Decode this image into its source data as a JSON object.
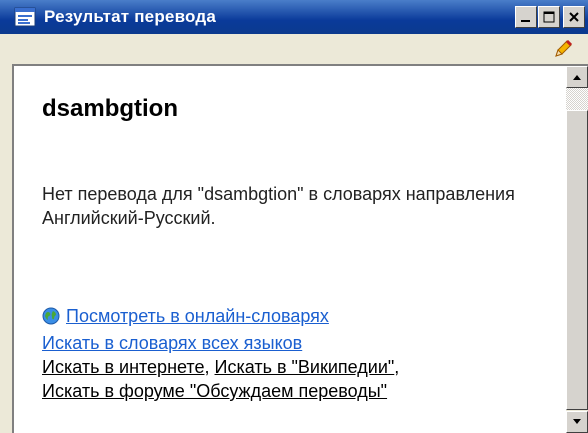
{
  "window": {
    "title": "Результат перевода",
    "icons": {
      "app": "dictionary-window-icon",
      "tool": "pencil-icon"
    }
  },
  "content": {
    "word": "dsambgtion",
    "message": "Нет перевода для \"dsambgtion\" в словарях направления Английский-Русский.",
    "links": {
      "online": "Посмотреть в онлайн-словарях",
      "all_languages": "Искать в словарях всех языков",
      "internet": "Искать в интернете",
      "wikipedia": "Искать в \"Википедии\"",
      "forum": "Искать в форуме \"Обсуждаем переводы\""
    },
    "separators": {
      "comma": ","
    }
  },
  "colors": {
    "titlebar": "#0a3a9a",
    "link_blue": "#1a5fd0",
    "window_bg": "#ece9d8"
  }
}
